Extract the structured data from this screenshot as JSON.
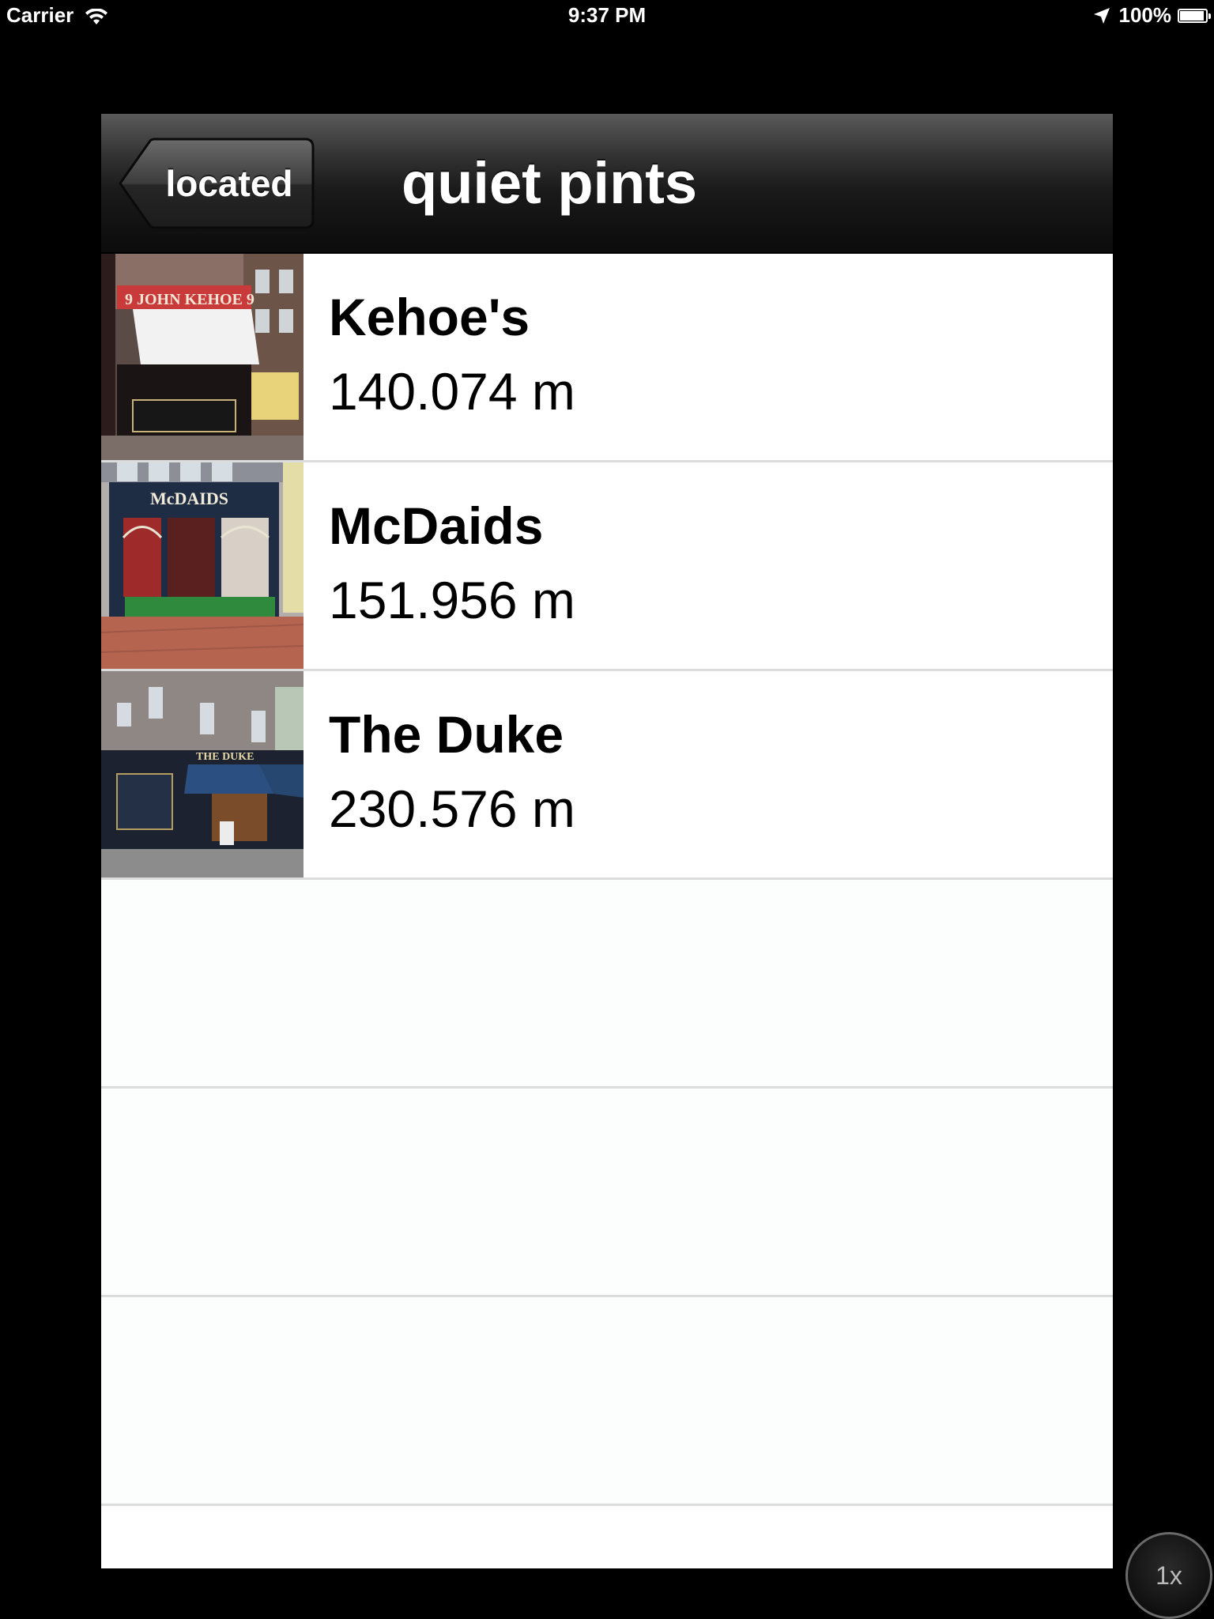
{
  "status_bar": {
    "carrier": "Carrier",
    "time": "9:37 PM",
    "battery_percent": "100%",
    "battery_level": 1.0,
    "icons": [
      "wifi-icon",
      "location-arrow-icon",
      "battery-icon"
    ]
  },
  "navbar": {
    "back_label": "located",
    "title": "quiet pints"
  },
  "pubs": [
    {
      "name": "Kehoe's",
      "distance": "140.074 m",
      "sign": "9 JOHN KEHOE 9",
      "icon": "pub-photo-kehoes"
    },
    {
      "name": "McDaids",
      "distance": "151.956 m",
      "sign": "McDAIDS",
      "icon": "pub-photo-mcdaids"
    },
    {
      "name": "The Duke",
      "distance": "230.576 m",
      "sign": "THE DUKE",
      "icon": "pub-photo-the-duke"
    }
  ],
  "zoom_badge": "1x",
  "colors": {
    "background": "#000000",
    "navbar": "#1a1a1a",
    "separator": "#dcdcdc"
  }
}
